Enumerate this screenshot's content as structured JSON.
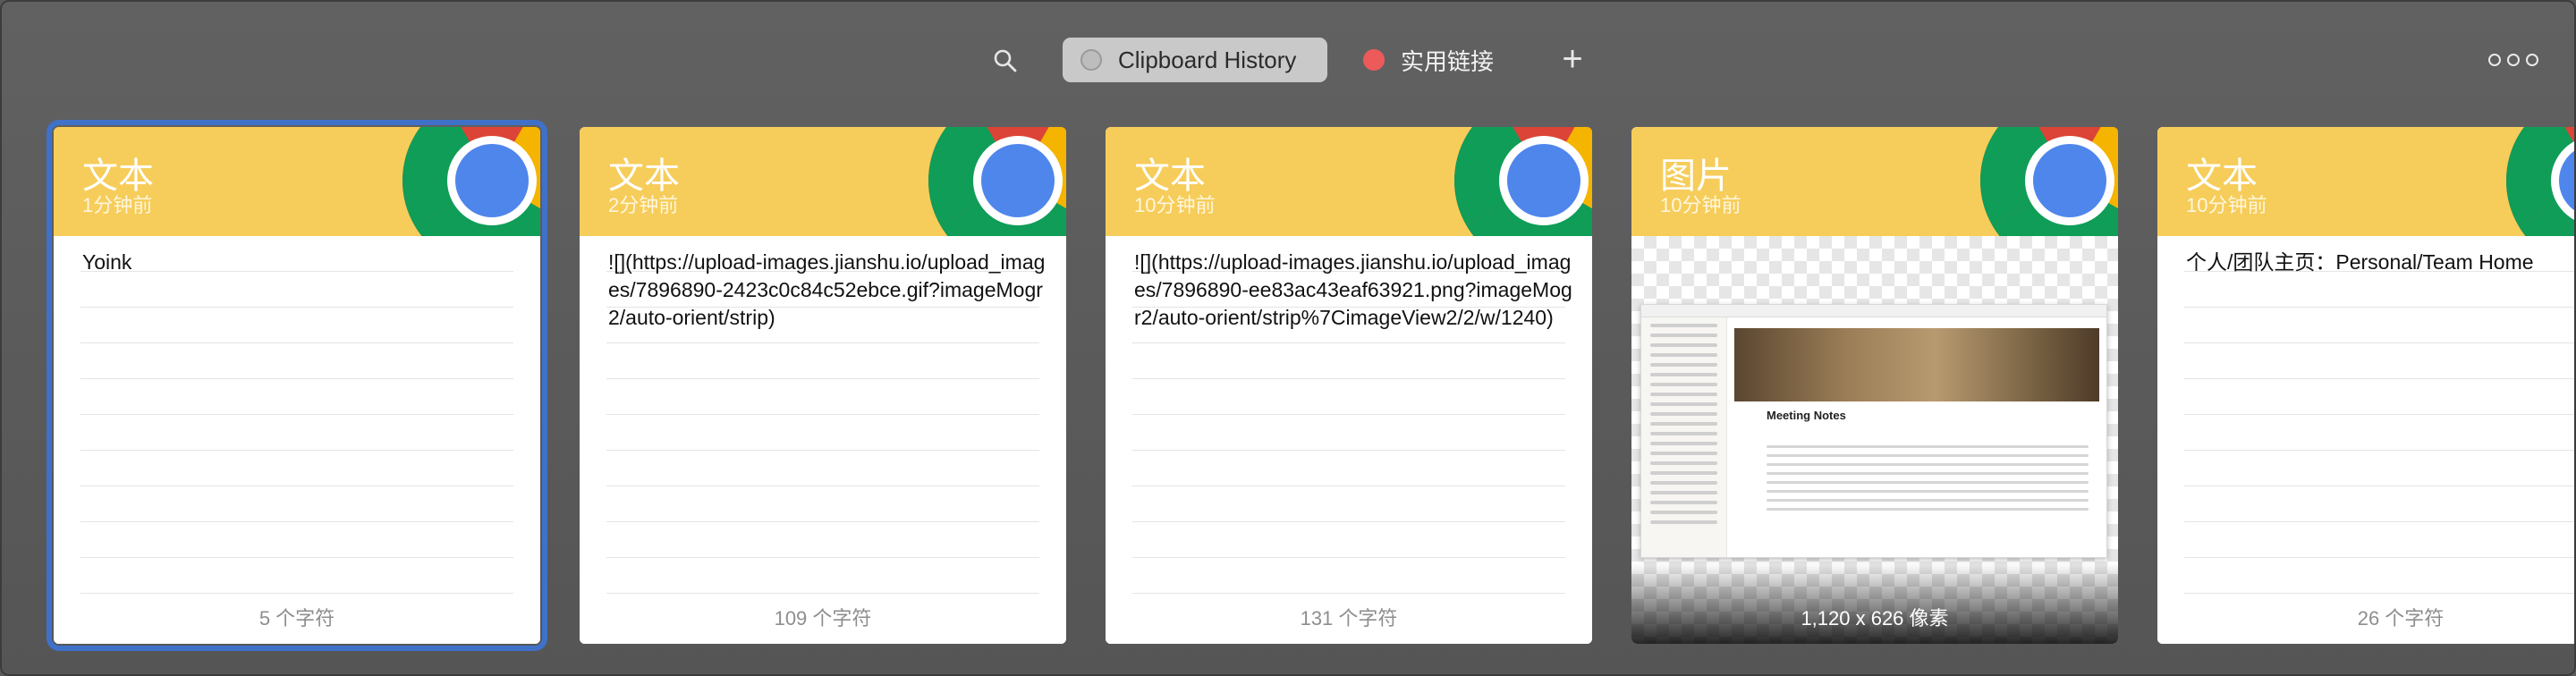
{
  "toolbar": {
    "search_icon": "search-icon",
    "tabs": [
      {
        "label": "Clipboard History",
        "active": true,
        "dot_color": "#bdbdbd"
      },
      {
        "label": "实用链接",
        "active": false,
        "dot_color": "#ed5a5a"
      }
    ],
    "add_label": "+",
    "more_icon": "more-icon"
  },
  "colors": {
    "header_yellow": "#f6cd5a",
    "selection_blue": "#3f71c9",
    "background": "#5a5a5a"
  },
  "cards": [
    {
      "type": "文本",
      "time": "1分钟前",
      "content": "Yoink",
      "footer": "5 个字符",
      "app_icon": "chrome-icon",
      "selected": true
    },
    {
      "type": "文本",
      "time": "2分钟前",
      "content": "![](https://upload-images.jianshu.io/upload_images/7896890-2423c0c84c52ebce.gif?imageMogr2/auto-orient/strip)",
      "footer": "109 个字符",
      "app_icon": "chrome-icon",
      "selected": false
    },
    {
      "type": "文本",
      "time": "10分钟前",
      "content": "![](https://upload-images.jianshu.io/upload_images/7896890-ee83ac43eaf63921.png?imageMogr2/auto-orient/strip%7CimageView2/2/w/1240)",
      "footer": "131 个字符",
      "app_icon": "chrome-icon",
      "selected": false
    },
    {
      "type": "图片",
      "time": "10分钟前",
      "image_title": "Meeting Notes",
      "footer": "1,120 x 626 像素",
      "app_icon": "chrome-icon",
      "selected": false
    },
    {
      "type": "文本",
      "time": "10分钟前",
      "content": "个人/团队主页：Personal/Team Home",
      "footer": "26 个字符",
      "app_icon": "chrome-icon",
      "selected": false
    }
  ]
}
